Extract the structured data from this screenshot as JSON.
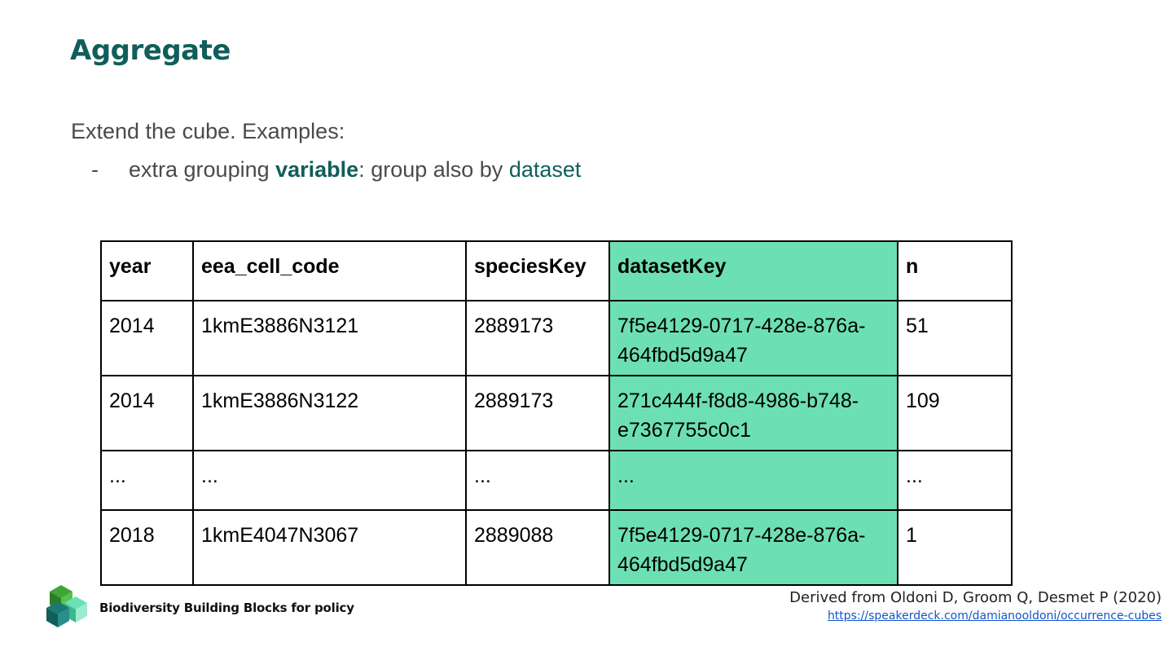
{
  "slide": {
    "title": "Aggregate",
    "intro": "Extend the cube. Examples:",
    "bullet": {
      "dash": "-",
      "prefix": "extra grouping ",
      "bold_term": "variable",
      "middle": ": group also by ",
      "accent_term": "dataset"
    }
  },
  "table": {
    "headers": [
      "year",
      "eea_cell_code",
      "speciesKey",
      "datasetKey",
      "n"
    ],
    "rows": [
      [
        "2014",
        "1kmE3886N3121",
        "2889173",
        "7f5e4129-0717-428e-876a-464fbd5d9a47",
        "51"
      ],
      [
        "2014",
        "1kmE3886N3122",
        "2889173",
        "271c444f-f8d8-4986-b748-e7367755c0c1",
        "109"
      ],
      [
        "...",
        "...",
        "...",
        "...",
        "..."
      ],
      [
        "2018",
        "1kmE4047N3067",
        "2889088",
        "7f5e4129-0717-428e-876a-464fbd5d9a47",
        "1"
      ]
    ],
    "highlight_color": "#6ddfb5"
  },
  "footer": {
    "logo_text": "Biodiversity Building Blocks for policy",
    "credit": "Derived from Oldoni D, Groom Q, Desmet P (2020)",
    "link": "https://speakerdeck.com/damianooldoni/occurrence-cubes"
  },
  "colors": {
    "accent": "#0f5e5b",
    "logo_green": "#3fa535",
    "logo_teal": "#0f5e5b",
    "logo_mint": "#6ddfb5"
  }
}
